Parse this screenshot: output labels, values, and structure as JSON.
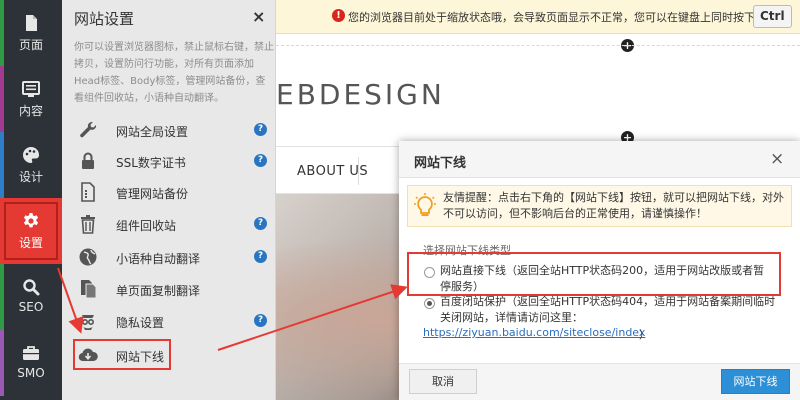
{
  "rail": {
    "items": [
      {
        "label": "页面",
        "icon": "file-icon",
        "bar": "#2f9c45"
      },
      {
        "label": "内容",
        "icon": "content-icon",
        "bar": "#a23b8f"
      },
      {
        "label": "设计",
        "icon": "palette-icon",
        "bar": "#2d7fc8"
      },
      {
        "label": "设置",
        "icon": "gear-icon",
        "bar": "#e53a33",
        "active": true
      },
      {
        "label": "SEO",
        "icon": "magnifier-icon",
        "bar": "#2f9c45"
      },
      {
        "label": "SMO",
        "icon": "briefcase-icon",
        "bar": "#9b59b6"
      }
    ]
  },
  "panel": {
    "title": "网站设置",
    "close": "×",
    "description": "你可以设置浏览器图标，禁止鼠标右键，禁止拷贝，设置防问行功能，对所有页面添加Head标签、Body标签，管理网站备份，查看组件回收站，小语种自动翻译。",
    "items": [
      {
        "label": "网站全局设置",
        "icon": "wrench-icon",
        "help": "?"
      },
      {
        "label": "SSL数字证书",
        "icon": "lock-icon",
        "help": "?"
      },
      {
        "label": "管理网站备份",
        "icon": "backup-file-icon",
        "help": ""
      },
      {
        "label": "组件回收站",
        "icon": "trash-icon",
        "help": "?"
      },
      {
        "label": "小语种自动翻译",
        "icon": "globe-icon",
        "help": "?"
      },
      {
        "label": "单页面复制翻译",
        "icon": "copy-icon",
        "help": ""
      },
      {
        "label": "隐私设置",
        "icon": "privacy-icon",
        "help": "?"
      },
      {
        "label": "网站下线",
        "icon": "cloud-download-icon",
        "help": "",
        "highlighted": true
      }
    ]
  },
  "preview": {
    "notice_icon": "!",
    "notice_text": "您的浏览器目前处于缩放状态哦，会导致页面显示不正常，您可以在键盘上同时按下",
    "notice_key": "Ctrl",
    "plus": "+",
    "brand": "EBDESIGN",
    "nav_item": "ABOUT US"
  },
  "modal": {
    "title": "网站下线",
    "close": "×",
    "tip": "友情提醒：点击右下角的【网站下线】按钮，就可以把网站下线，对外不可以访问，但不影响后台的正常使用，请谨慎操作！",
    "choose_label": "选择网站下线类型",
    "options": [
      {
        "text": "网站直接下线（返回全站HTTP状态码200，适用于网站改版或者暂停服务）",
        "checked": false
      },
      {
        "text": "百度闭站保护（返回全站HTTP状态码404，适用于网站备案期间临时关闭网站，详情请访问这里：",
        "link": "https://ziyuan.baidu.com/siteclose/index",
        "link_close": "）",
        "checked": true
      }
    ],
    "cancel_label": "取消",
    "confirm_label": "网站下线"
  },
  "colors": {
    "accent_red": "#e53a33",
    "primary_blue": "#2d8fd6",
    "rail_bg": "#2d3238"
  }
}
